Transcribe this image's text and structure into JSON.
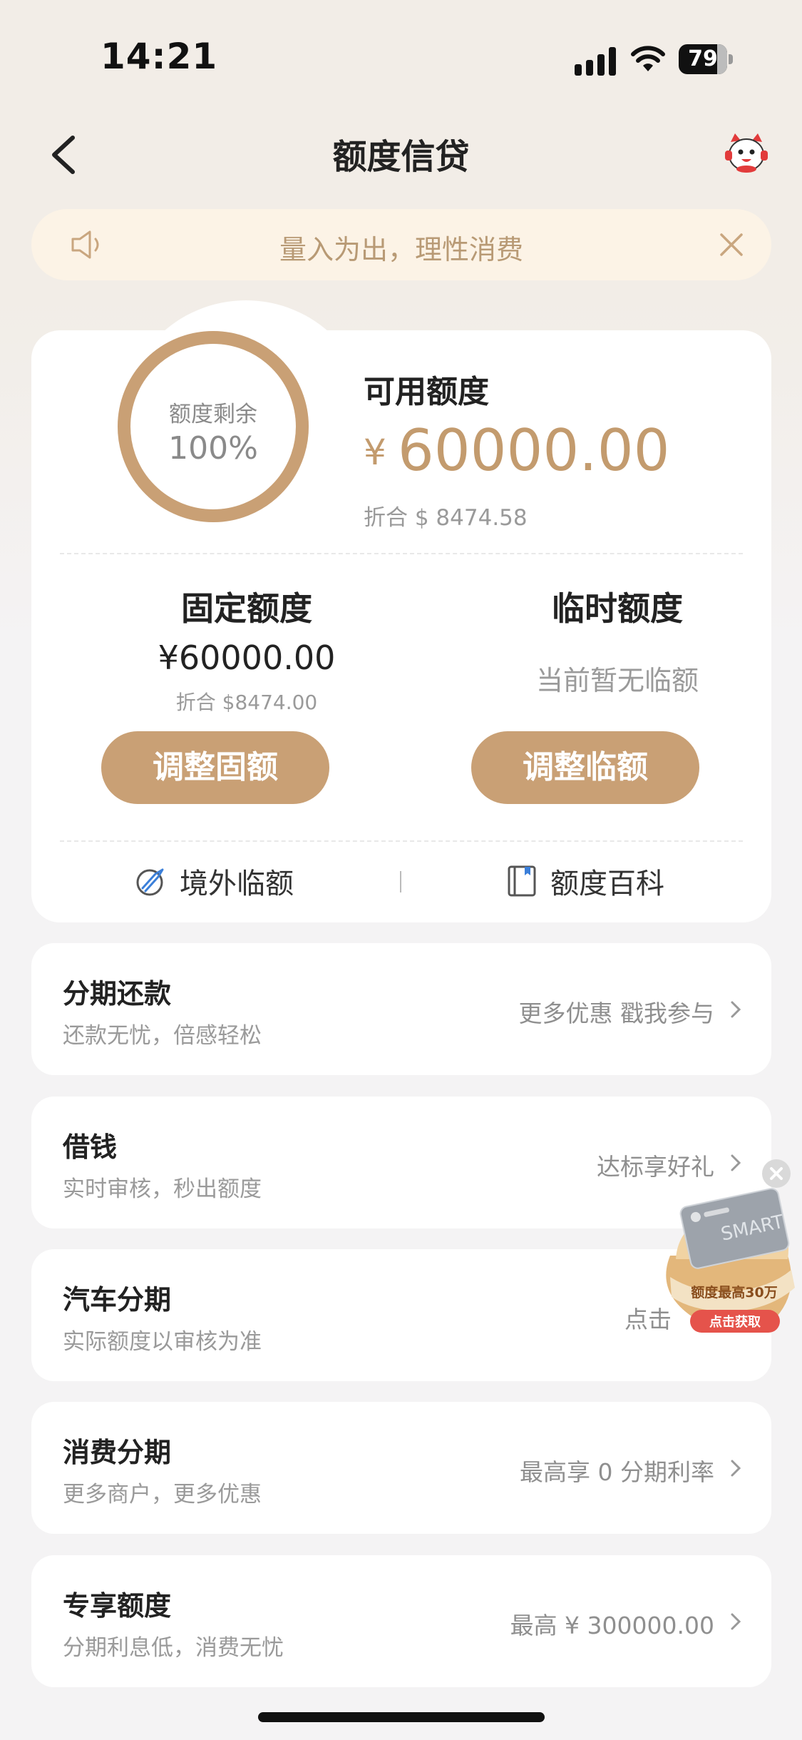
{
  "status_bar": {
    "time": "14:21",
    "battery": "79",
    "battery_level": 0.79
  },
  "nav": {
    "title": "额度信贷"
  },
  "notice": {
    "text": "量入为出，理性消费"
  },
  "credit": {
    "ring_label": "额度剩余",
    "ring_percent": "100%",
    "ring_fraction": 1.0,
    "available_label": "可用额度",
    "available_currency": "¥",
    "available_amount": "60000.00",
    "available_converted": "折合 $ 8474.58",
    "fixed": {
      "title": "固定额度",
      "amount": "¥60000.00",
      "converted": "折合 $8474.00",
      "button": "调整固额"
    },
    "temporary": {
      "title": "临时额度",
      "status": "当前暂无临额",
      "button": "调整临额"
    },
    "links": {
      "overseas": "境外临额",
      "encyclopedia": "额度百科"
    }
  },
  "items": [
    {
      "title": "分期还款",
      "subtitle": "还款无忧，倍感轻松",
      "right": "更多优惠 戳我参与"
    },
    {
      "title": "借钱",
      "subtitle": "实时审核，秒出额度",
      "right": "达标享好礼"
    },
    {
      "title": "汽车分期",
      "subtitle": "实际额度以审核为准",
      "right": "点击"
    },
    {
      "title": "消费分期",
      "subtitle": "更多商户，更多优惠",
      "right": "最高享 0 分期利率"
    },
    {
      "title": "专享额度",
      "subtitle": "分期利息低，消费无忧",
      "right": "最高 ¥ 300000.00"
    }
  ],
  "float_ad": {
    "card_text": "SMART",
    "line1": "额度最高30万",
    "button": "点击获取"
  },
  "colors": {
    "gold": "#c9a075",
    "notice_bg": "#fcf3e6",
    "notice_text": "#b89a75",
    "ring": "#c9a075"
  }
}
